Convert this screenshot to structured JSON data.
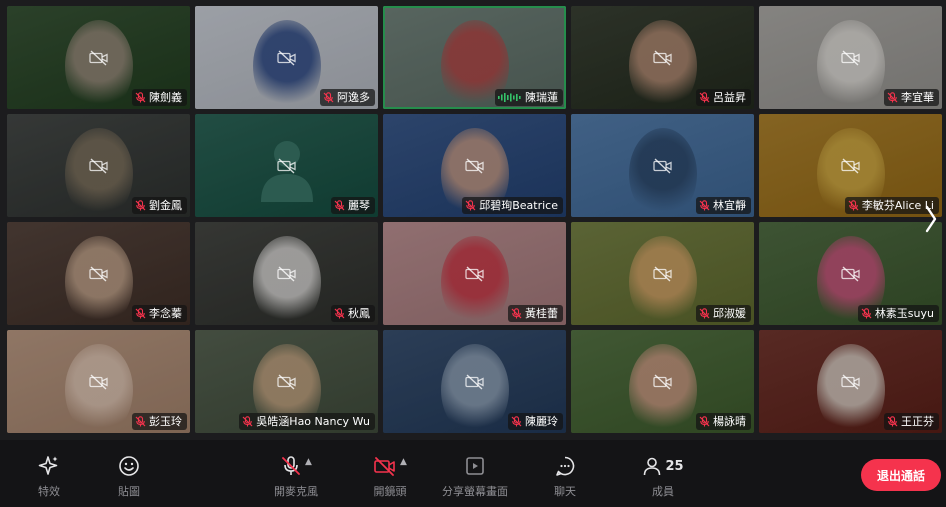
{
  "participants": [
    {
      "name": "陳劍義",
      "bg": "#3c5a3a",
      "accent": "#a89888",
      "talking": false
    },
    {
      "name": "阿逸多",
      "bg": "#d8dde6",
      "accent": "#2b4a8c",
      "talking": false
    },
    {
      "name": "陳瑞蓮",
      "bg": "#7a8c84",
      "accent": "#c24a4a",
      "talking": true
    },
    {
      "name": "呂益昇",
      "bg": "#3e4638",
      "accent": "#c79a80",
      "talking": false
    },
    {
      "name": "李宜華",
      "bg": "#b8b6b2",
      "accent": "#f2efea",
      "talking": false
    },
    {
      "name": "劉金鳳",
      "bg": "#4a4e4c",
      "accent": "#8a7c66",
      "talking": false
    },
    {
      "name": "麗琴",
      "bg": "#2f6b5d",
      "accent": "#3d7f70",
      "talking": false,
      "placeholder": true
    },
    {
      "name": "邱碧珣Beatrice",
      "bg": "#3e5f94",
      "accent": "#d8a890",
      "talking": false
    },
    {
      "name": "林宜靜",
      "bg": "#5a86b8",
      "accent": "#2f4c70",
      "talking": false
    },
    {
      "name": "李敏芬Alice Li",
      "bg": "#b88a30",
      "accent": "#e0b84a",
      "talking": false
    },
    {
      "name": "李念蓁",
      "bg": "#5c4a42",
      "accent": "#d6b59a",
      "talking": false
    },
    {
      "name": "秋鳳",
      "bg": "#4a4c48",
      "accent": "#f2f0ee",
      "talking": false
    },
    {
      "name": "黃桂蕾",
      "bg": "#c89a9c",
      "accent": "#d83a4a",
      "talking": false
    },
    {
      "name": "邱淑媛",
      "bg": "#7e8a4a",
      "accent": "#e6b070",
      "talking": false
    },
    {
      "name": "林素玉suyu",
      "bg": "#567448",
      "accent": "#e05a8a",
      "talking": false
    },
    {
      "name": "彭玉玲",
      "bg": "#c7a48c",
      "accent": "#f0d6c4",
      "talking": false
    },
    {
      "name": "吳皓涵Hao Nancy Wu",
      "bg": "#5d6a58",
      "accent": "#d8b48e",
      "talking": false
    },
    {
      "name": "陳麗玲",
      "bg": "#3d5678",
      "accent": "#9fb2c8",
      "talking": false
    },
    {
      "name": "楊詠晴",
      "bg": "#5a7a48",
      "accent": "#e0a890",
      "talking": false
    },
    {
      "name": "王正芬",
      "bg": "#7a3a32",
      "accent": "#efe6dc",
      "talking": false
    }
  ],
  "toolbar": {
    "effects_label": "特效",
    "stickers_label": "貼圖",
    "mic_label": "開麥克風",
    "camera_label": "開鏡頭",
    "share_label": "分享螢幕畫面",
    "chat_label": "聊天",
    "members_label": "成員",
    "members_count": "25",
    "leave_label": "退出通話"
  },
  "colors": {
    "leave": "#f5334d",
    "talking_border": "#35c46a",
    "muted_mic": "#f5334d"
  },
  "icons": [
    "sparkle-icon",
    "smiley-icon",
    "mic-off-icon",
    "camera-off-icon",
    "share-screen-icon",
    "chat-icon",
    "person-icon",
    "chevron-right-icon"
  ]
}
